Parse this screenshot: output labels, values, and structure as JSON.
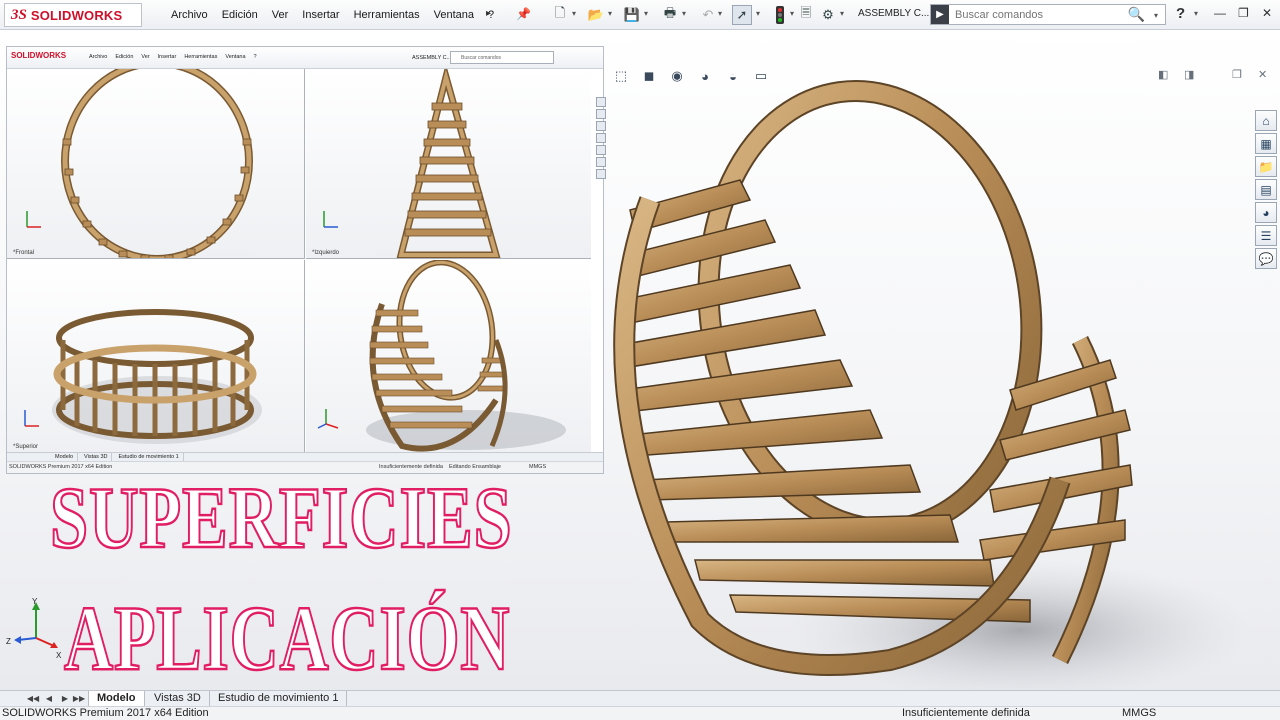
{
  "app": {
    "brand": "SOLIDWORKS",
    "brand_mark": "3S"
  },
  "menu": {
    "items": [
      "Archivo",
      "Edición",
      "Ver",
      "Insertar",
      "Herramientas",
      "Ventana",
      "?"
    ]
  },
  "toolbar": {
    "document_title": "ASSEMBLY C...",
    "search_placeholder": "Buscar comandos",
    "help_label": "?"
  },
  "inset": {
    "brand": "SOLIDWORKS",
    "menu_items": [
      "Archivo",
      "Edición",
      "Ver",
      "Insertar",
      "Herramientas",
      "Ventana",
      "?"
    ],
    "document_title": "ASSEMBLY C...",
    "search_placeholder": "Buscar comandos",
    "views": {
      "front": "*Frontal",
      "left": "*Izquierdo",
      "top": "*Superior"
    },
    "tabs": [
      "Modelo",
      "Vistas 3D",
      "Estudio de movimiento 1"
    ],
    "status": {
      "product": "SOLIDWORKS Premium 2017 x64 Edition",
      "definition": "Insuficientemente definida",
      "editing": "Editando Ensamblaje",
      "units": "MMGS"
    }
  },
  "overlay_text": {
    "line1": "SUPERFICIES",
    "line2": "APLICACIÓN"
  },
  "triad": {
    "x": "X",
    "y": "Y",
    "z": "Z"
  },
  "bottom_tabs": [
    "Modelo",
    "Vistas 3D",
    "Estudio de movimiento 1"
  ],
  "status": {
    "product": "SOLIDWORKS Premium 2017 x64 Edition",
    "definition": "Insuficientemente definida",
    "units": "MMGS"
  },
  "colors": {
    "brand_red": "#d0102a",
    "title_outline": "#e11d63",
    "wood": "#b98d57",
    "wood_dark": "#7a5a33",
    "wood_light": "#d8b684"
  }
}
